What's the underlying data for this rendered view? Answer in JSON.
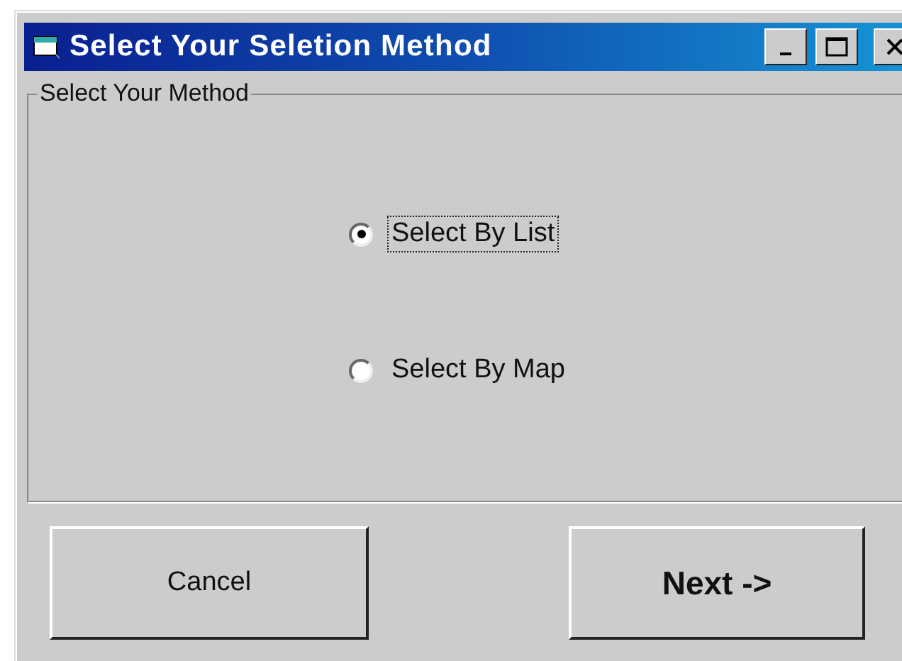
{
  "window": {
    "title": "Select Your Seletion Method"
  },
  "group": {
    "label": "Select Your Method"
  },
  "options": [
    {
      "label": "Select By List",
      "selected": true
    },
    {
      "label": "Select By Map",
      "selected": false
    }
  ],
  "buttons": [
    {
      "label": "Cancel",
      "kind": "normal"
    },
    {
      "label": "Next ->",
      "kind": "default"
    }
  ]
}
